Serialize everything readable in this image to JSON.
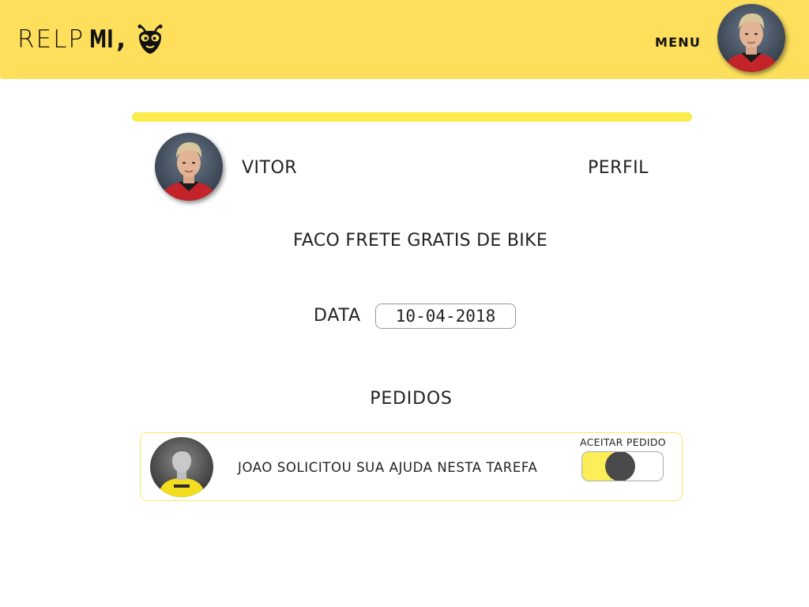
{
  "header": {
    "logo_text": "RELP",
    "logo_bold": "MI",
    "logo_comma": ",",
    "menu_label": "MENU",
    "avatar_icon": "user-avatar"
  },
  "progress": {
    "value": 1.0,
    "color": "#fbeb4d"
  },
  "profile": {
    "name": "VITOR",
    "profile_link": "PERFIL"
  },
  "task": {
    "title": "FACO FRETE GRATIS DE BIKE",
    "date_label": "DATA",
    "date_value": "10-04-2018"
  },
  "orders": {
    "heading": "PEDIDOS",
    "items": [
      {
        "text": "JOAO SOLICITOU SUA AJUDA NESTA TAREFA",
        "accept_label": "ACEITAR PEDIDO",
        "accepted": true
      }
    ]
  },
  "colors": {
    "brand_yellow": "#fddf5c",
    "accent_yellow": "#fbeb4d",
    "toggle_knob": "#4a4a4a"
  }
}
